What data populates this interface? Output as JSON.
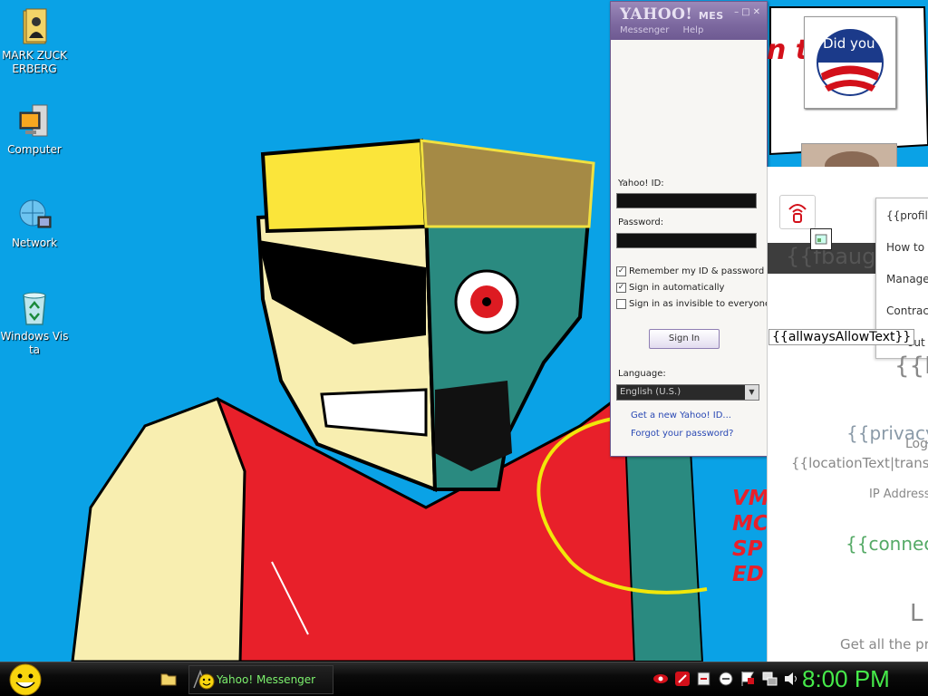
{
  "desktop_icons": [
    {
      "label": "MARK ZUCKERBERG",
      "icon": "folder-user-icon"
    },
    {
      "label": "Computer",
      "icon": "computer-icon"
    },
    {
      "label": "Network",
      "icon": "network-icon"
    },
    {
      "label": "Windows Vista",
      "icon": "recycle-bin-icon"
    }
  ],
  "messenger": {
    "title": "YAHOO! MESSENGER",
    "logo_main": "YAHOO!",
    "logo_sub": "MES",
    "menu": [
      "Messenger",
      "Help"
    ],
    "yahoo_id_label": "Yahoo! ID:",
    "yahoo_id_value": "",
    "password_label": "Password:",
    "password_value": "",
    "remember_label": "Remember my ID & password",
    "remember_checked": true,
    "auto_label": "Sign in automatically",
    "auto_checked": true,
    "invisible_label": "Sign in as invisible to everyone",
    "invisible_checked": false,
    "signin_label": "Sign In",
    "language_label": "Language:",
    "language_value": "English (U.S.)",
    "link_new_id": "Get a new Yahoo! ID...",
    "link_forgot": "Forgot your password?"
  },
  "web_panel": {
    "darkbar_text": "{{fbaugu",
    "menu_items": [
      "{{profile",
      "How to",
      "Manage",
      "Contract",
      "out"
    ],
    "always_allow": "{{allwaysAllowText}}",
    "template_lines": [
      {
        "text": "{{L",
        "color": "#888888"
      },
      {
        "text": "{{privacyT",
        "color": "#8a9aa8"
      },
      {
        "text": "Log",
        "color": "#888888"
      },
      {
        "text": "{{locationText|transla",
        "color": "#888888"
      },
      {
        "text": "IP Address",
        "color": "#888888"
      },
      {
        "text": "{{connect",
        "color": "#55aa66"
      },
      {
        "text": "L",
        "color": "#888888"
      },
      {
        "text": "Get all the pro",
        "color": "#888888"
      }
    ]
  },
  "wallpaper_text": {
    "partial_speech": "n t",
    "side_words": [
      "VM",
      "MC",
      "SP",
      "ED"
    ],
    "photo_caption": "Did you"
  },
  "taskbar": {
    "task_label": "Yahoo! Messenger",
    "clock": "8:00 PM"
  },
  "colors": {
    "desktop_bg": "#0aa2e6",
    "messenger_purple": "#7c689f",
    "clock_green": "#46ea4a",
    "task_text_green": "#7cf06d"
  }
}
